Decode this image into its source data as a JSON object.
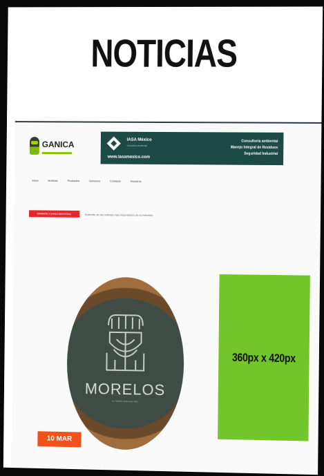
{
  "heading": {
    "title": "NOTICIAS"
  },
  "site": {
    "logo_text": "GANICA",
    "nav": [
      "Inicio",
      "Noticias",
      "Productos",
      "Servicios",
      "Contacto",
      "Nosotros"
    ]
  },
  "banner": {
    "brand": "IASA México",
    "brand_sub": "Consultoría Ambiental",
    "url": "www.iasamexico.com",
    "lines": [
      "Consultoría ambiental",
      "Manejo Integral de Residuos",
      "Seguridad Industrial"
    ]
  },
  "ticker": {
    "label": "ENTÉRATE A GANICA INDUSTRIAL",
    "text": "Entérate de las noticias más importantes de la industria"
  },
  "news": {
    "image_title": "MORELOS",
    "image_sub": "AL TIEMPO QUE NOS UNE",
    "date": "10 MAR"
  },
  "ad": {
    "label": "360px x 420px"
  },
  "colors": {
    "banner": "#1d4a44",
    "ticker": "#e8252c",
    "date_badge": "#f1511b",
    "ad": "#72c52a"
  }
}
